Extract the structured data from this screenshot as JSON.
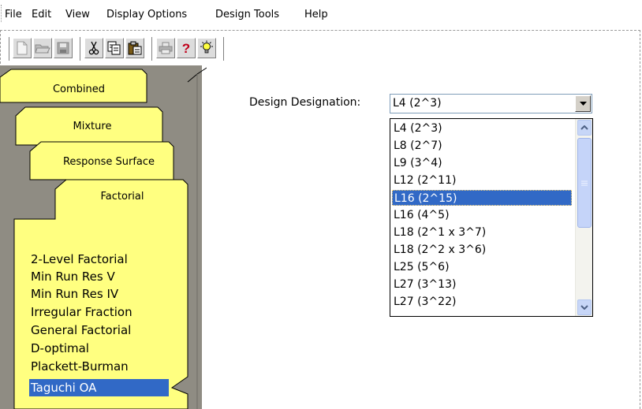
{
  "menu": [
    "File",
    "Edit",
    "View",
    "Display Options",
    "Design Tools",
    "Help"
  ],
  "toolbar": {
    "icons": [
      "new-file-icon",
      "open-folder-icon",
      "save-icon",
      "cut-icon",
      "copy-icon",
      "paste-icon",
      "print-icon",
      "help-question-icon",
      "tip-lightbulb-icon"
    ]
  },
  "tabs": [
    "Combined",
    "Mixture",
    "Response Surface",
    "Factorial"
  ],
  "design_types": {
    "items": [
      "2-Level Factorial",
      "Min Run Res V",
      "Min Run Res IV",
      "Irregular Fraction",
      "General Factorial",
      "D-optimal",
      "Plackett-Burman",
      "Taguchi OA"
    ],
    "selected": "Taguchi OA"
  },
  "design_designation": {
    "label": "Design Designation:",
    "value": "L4 (2^3)",
    "options": [
      "L4 (2^3)",
      "L8 (2^7)",
      "L9 (3^4)",
      "L12 (2^11)",
      "L16 (2^15)",
      "L16 (4^5)",
      "L18 (2^1 x 3^7)",
      "L18 (2^2 x 3^6)",
      "L25 (5^6)",
      "L27 (3^13)",
      "L27 (3^22)"
    ],
    "highlighted": "L16 (2^15)"
  },
  "colors": {
    "tab_yellow": "#ffff80",
    "tab_area_bg": "#8f8c83",
    "selection_blue": "#3169c6",
    "scrollbar_blue": "#c5d4f9"
  }
}
